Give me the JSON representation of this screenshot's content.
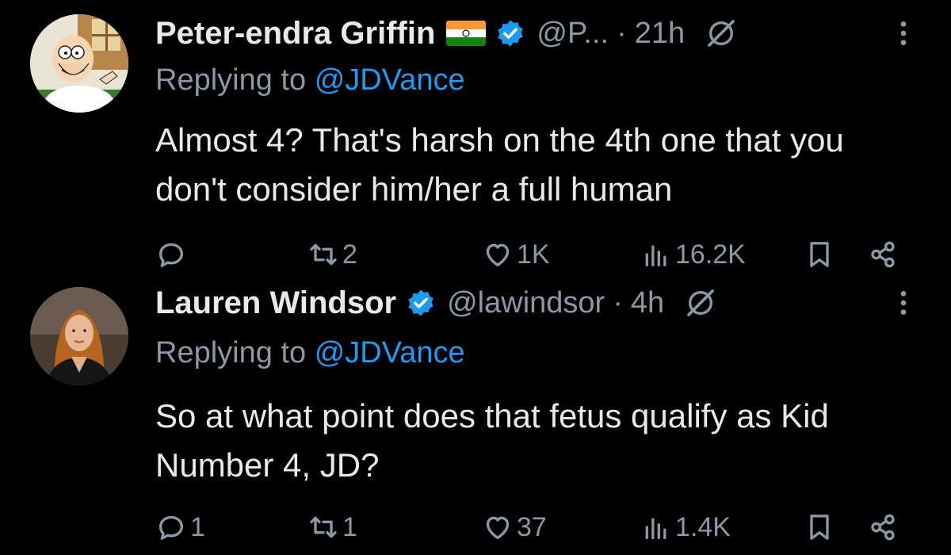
{
  "tweets": [
    {
      "display_name": "Peter-endra Griffin",
      "handle": "@P...",
      "separator": "·",
      "time": "21h",
      "replying_prefix": "Replying to",
      "replying_mention": "@JDVance",
      "text": "Almost 4? That's harsh on the 4th one that you don't consider him/her a full human",
      "replies": "",
      "reposts": "2",
      "likes": "1K",
      "views": "16.2K",
      "icons": [
        "avatar",
        "india-flag-icon",
        "verified-badge-icon",
        "grok-icon",
        "more-icon",
        "reply-icon",
        "repost-icon",
        "like-icon",
        "views-icon",
        "bookmark-icon",
        "share-icon"
      ]
    },
    {
      "display_name": "Lauren Windsor",
      "handle": "@lawindsor",
      "separator": "·",
      "time": "4h",
      "replying_prefix": "Replying to",
      "replying_mention": "@JDVance",
      "text": "So at what point does that fetus qualify as Kid Number 4, JD?",
      "replies": "1",
      "reposts": "1",
      "likes": "37",
      "views": "1.4K",
      "icons": [
        "avatar",
        "verified-badge-icon",
        "grok-icon",
        "more-icon",
        "reply-icon",
        "repost-icon",
        "like-icon",
        "views-icon",
        "bookmark-icon",
        "share-icon"
      ]
    }
  ],
  "colors": {
    "background": "#000000",
    "text_primary": "#e7e9ea",
    "text_secondary": "#8b98a5",
    "link": "#1d9bf0",
    "verified": "#1d9bf0"
  }
}
